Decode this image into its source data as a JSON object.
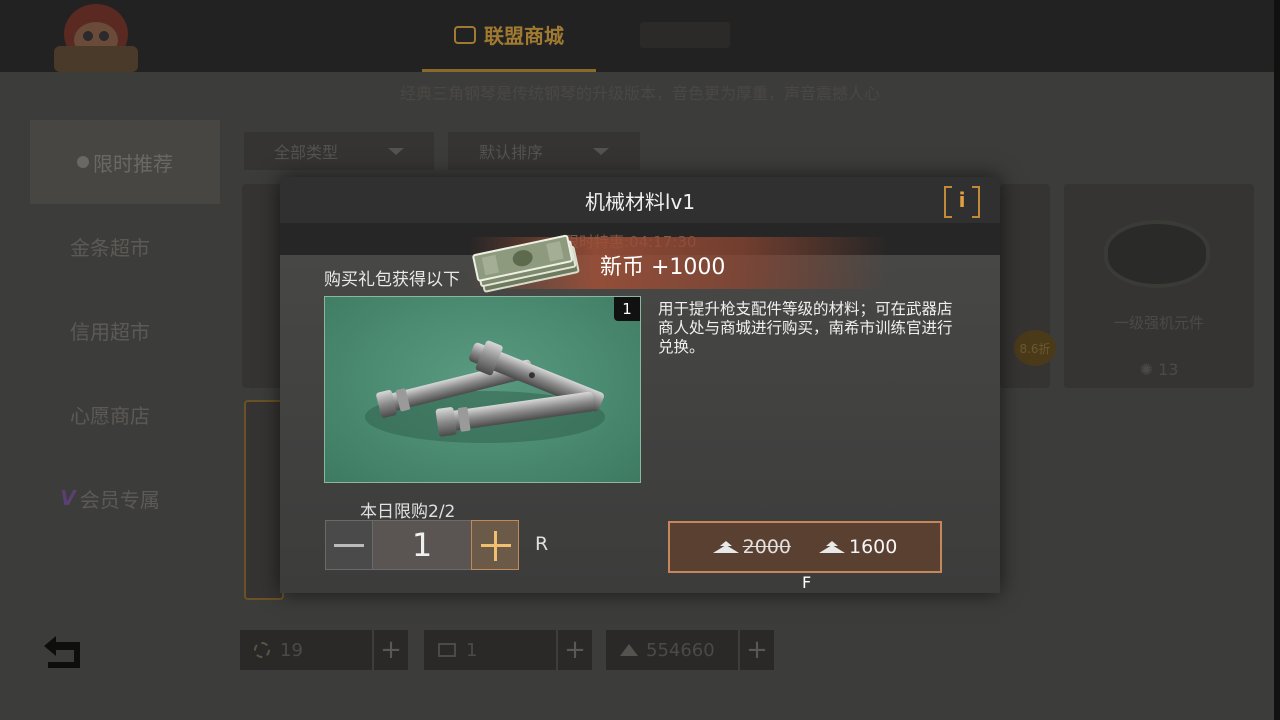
{
  "header": {
    "active_tab": "联盟商城",
    "marquee": "经典三角钢琴是传统钢琴的升级版本，音色更为厚重，声音震撼人心"
  },
  "sidebar": {
    "items": [
      {
        "label": "限时推荐",
        "active": true
      },
      {
        "label": "金条超市"
      },
      {
        "label": "信用超市"
      },
      {
        "label": "心愿商店"
      },
      {
        "label": "会员专属",
        "prefix": "V"
      }
    ]
  },
  "filters": {
    "category": "全部类型",
    "sort": "默认排序"
  },
  "bg_cards": {
    "right_card_name": "一级强机元件",
    "right_card_price": "13",
    "discount": "8.6折"
  },
  "currencies": [
    {
      "icon": "coin-icon",
      "value": "19"
    },
    {
      "icon": "ticket-icon",
      "value": "1"
    },
    {
      "icon": "gold-bar-icon",
      "value": "554660"
    }
  ],
  "modal": {
    "title": "机械材料lv1",
    "info_label": "i",
    "timer": "限时特惠:04:17:30",
    "reward": "新币 +1000",
    "gift_label": "购买礼包获得以下",
    "item_quantity": "1",
    "description": "用于提升枪支配件等级的材料；可在武器店商人处与商城进行购买，南希市训练官进行兑换。",
    "daily_limit": "本日限购2/2",
    "stepper_value": "1",
    "hint_right": "R",
    "original_price": "2000",
    "sale_price": "1600",
    "hint_buy": "F"
  },
  "colors": {
    "accent": "#c6885a",
    "buy_bg": "#5a4030",
    "item_bg": "#4a8a70"
  }
}
